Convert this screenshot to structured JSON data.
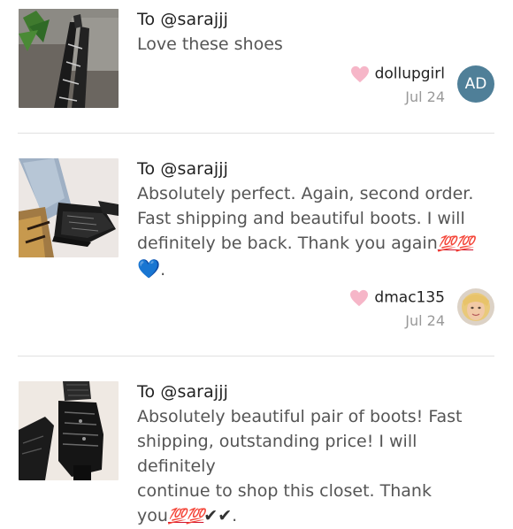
{
  "reviews": [
    {
      "to": "To @sarajjj",
      "message": "Love these shoes",
      "username": "dollupgirl",
      "date": "Jul 24",
      "avatar_initials": "AD"
    },
    {
      "to": "To @sarajjj",
      "message_lines": [
        "Absolutely perfect. Again, second order.",
        "Fast shipping and beautiful boots. I will",
        "definitely be back. Thank you again"
      ],
      "emoji_hundred": "💯",
      "emoji_blue_heart": "💙",
      "trailing": ".",
      "username": "dmac135",
      "date": "Jul 24"
    },
    {
      "to": "To @sarajjj",
      "message_lines": [
        "Absolutely beautiful pair of boots! Fast",
        "shipping, outstanding price! I will definitely",
        "continue to shop this closet. Thank",
        "you"
      ],
      "emoji_hundred": "💯",
      "emoji_check": "✔",
      "trailing": "."
    }
  ],
  "colors": {
    "heart": "#f6b6c8",
    "avatar_bg": "#4f7f98",
    "divider": "#e1e1e1",
    "hundred": "#d0102b"
  },
  "icons": [
    "heart-icon",
    "hundred-points-emoji",
    "blue-heart-emoji",
    "check-mark-emoji"
  ]
}
